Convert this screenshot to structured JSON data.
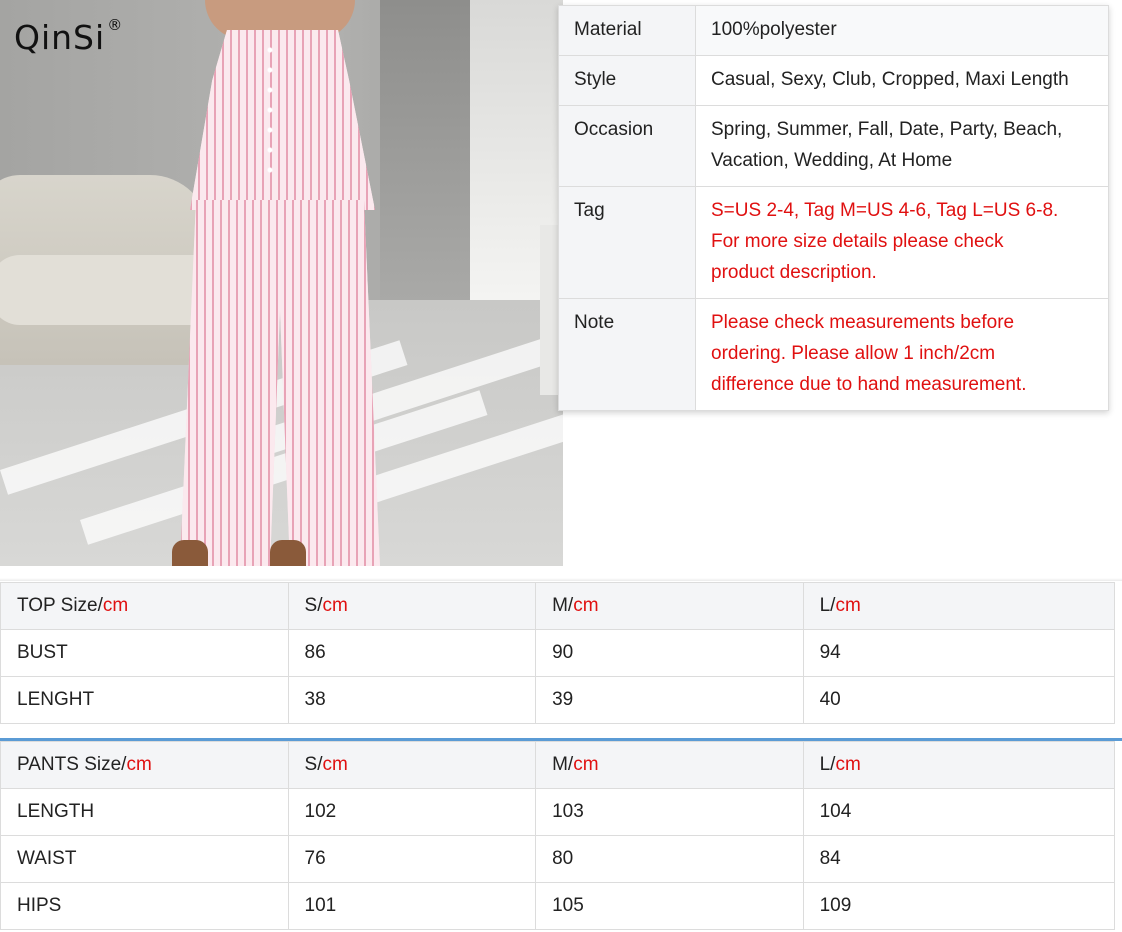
{
  "brand": {
    "logo_text": "QinSi",
    "registered_mark": "®"
  },
  "photo": {
    "subject": "pink-striped-cami-top-and-wide-leg-pants"
  },
  "info_table": [
    {
      "key": "Material",
      "value": [
        "100%polyester"
      ],
      "highlight": false
    },
    {
      "key": "Style",
      "value": [
        "Casual, Sexy, Club, Cropped, Maxi Length"
      ],
      "highlight": false
    },
    {
      "key": "Occasion",
      "value": [
        "Spring, Summer, Fall, Date, Party, Beach,",
        "Vacation, Wedding, At Home"
      ],
      "highlight": false
    },
    {
      "key": "Tag",
      "value": [
        "S=US 2-4, Tag M=US 4-6, Tag L=US 6-8.",
        "For more size details please check",
        "product description."
      ],
      "highlight": true
    },
    {
      "key": "Note",
      "value": [
        "Please check measurements before",
        "ordering. Please allow 1 inch/2cm",
        "difference due to hand measurement."
      ],
      "highlight": true
    }
  ],
  "top_size_table": {
    "header": [
      {
        "label": "TOP Size/",
        "unit": "cm"
      },
      {
        "label": "S/",
        "unit": "cm"
      },
      {
        "label": "M/",
        "unit": "cm"
      },
      {
        "label": "L/",
        "unit": "cm"
      }
    ],
    "rows": [
      [
        "BUST",
        "86",
        "90",
        "94"
      ],
      [
        "LENGHT",
        "38",
        "39",
        "40"
      ]
    ]
  },
  "pants_size_table": {
    "header": [
      {
        "label": "PANTS Size/",
        "unit": "cm"
      },
      {
        "label": "S/",
        "unit": "cm"
      },
      {
        "label": "M/",
        "unit": "cm"
      },
      {
        "label": "L/",
        "unit": "cm"
      }
    ],
    "rows": [
      [
        "LENGTH",
        "102",
        "103",
        "104"
      ],
      [
        "WAIST",
        "76",
        "80",
        "84"
      ],
      [
        "HIPS",
        "101",
        "105",
        "109"
      ]
    ]
  },
  "colors": {
    "accent_red": "#e01010",
    "header_bg": "#f4f5f7",
    "border": "#dcdcdc",
    "divider_blue": "#5b9bd5"
  }
}
